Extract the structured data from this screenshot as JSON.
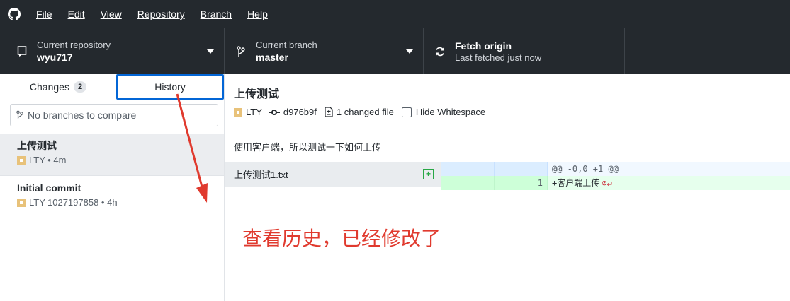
{
  "menu": {
    "items": [
      {
        "label": "File"
      },
      {
        "label": "Edit"
      },
      {
        "label": "View"
      },
      {
        "label": "Repository"
      },
      {
        "label": "Branch"
      },
      {
        "label": "Help"
      }
    ]
  },
  "toolbar": {
    "repo": {
      "label": "Current repository",
      "value": "wyu717"
    },
    "branch": {
      "label": "Current branch",
      "value": "master"
    },
    "fetch": {
      "label": "Fetch origin",
      "value": "Last fetched just now"
    }
  },
  "sidebar": {
    "tabs": [
      {
        "label": "Changes",
        "badge": "2"
      },
      {
        "label": "History"
      }
    ],
    "compare_placeholder": "No branches to compare",
    "commits": [
      {
        "title": "上传测试",
        "meta": "LTY • 4m"
      },
      {
        "title": "Initial commit",
        "meta": "LTY-1027197858 • 4h"
      }
    ]
  },
  "commit": {
    "title": "上传测试",
    "author": "LTY",
    "sha": "d976b9f",
    "changed_files": "1 changed file",
    "hide_whitespace_label": "Hide Whitespace",
    "description": "使用客户端，所以测试一下如何上传"
  },
  "files": [
    {
      "name": "上传测试1.txt",
      "status": "+"
    }
  ],
  "diff": {
    "hunk_header": "@@ -0,0 +1 @@",
    "lines": [
      {
        "new_no": "1",
        "text": "+客户端上传"
      }
    ]
  },
  "annotation": {
    "text": "查看历史，已经修改了"
  },
  "colors": {
    "toolbar_bg": "#24292e",
    "accent": "#0366d6",
    "annotation": "#e03a2e",
    "added_bg": "#e6ffed"
  }
}
